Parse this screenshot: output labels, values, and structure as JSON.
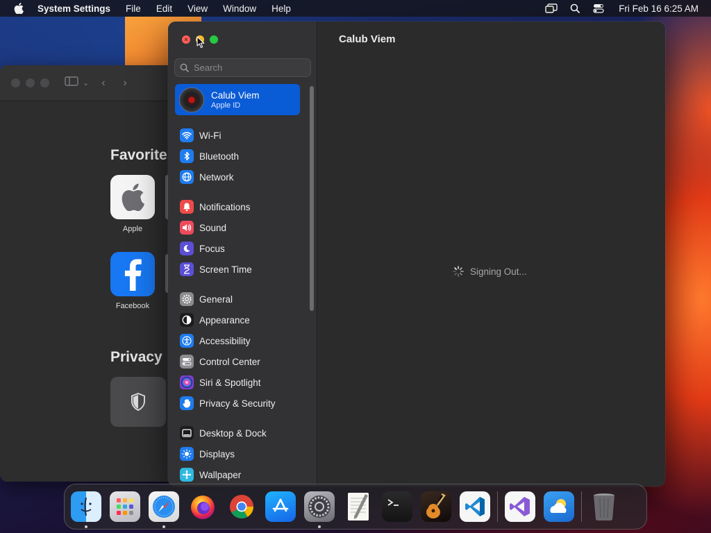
{
  "menubar": {
    "app_name": "System Settings",
    "items": [
      "File",
      "Edit",
      "View",
      "Window",
      "Help"
    ],
    "clock": "Fri Feb 16  6:25 AM"
  },
  "background_window": {
    "favorites_heading": "Favorite",
    "favorites": [
      {
        "label": "Apple",
        "icon": "apple-icon"
      },
      {
        "label": "Facebook",
        "icon": "facebook-icon"
      }
    ],
    "privacy_heading": "Privacy"
  },
  "settings": {
    "search_placeholder": "Search",
    "account": {
      "name": "Calub Viem",
      "subtitle": "Apple ID"
    },
    "nav_groups": [
      [
        {
          "label": "Wi-Fi",
          "icon": "wifi-icon",
          "color": "#1e7cf0"
        },
        {
          "label": "Bluetooth",
          "icon": "bluetooth-icon",
          "color": "#1e7cf0"
        },
        {
          "label": "Network",
          "icon": "globe-icon",
          "color": "#1e7cf0"
        }
      ],
      [
        {
          "label": "Notifications",
          "icon": "bell-icon",
          "color": "#ef4a4a"
        },
        {
          "label": "Sound",
          "icon": "speaker-icon",
          "color": "#ef4a5c"
        },
        {
          "label": "Focus",
          "icon": "moon-icon",
          "color": "#5b4fd6"
        },
        {
          "label": "Screen Time",
          "icon": "hourglass-icon",
          "color": "#5b4fd6"
        }
      ],
      [
        {
          "label": "General",
          "icon": "gear-icon",
          "color": "#8c8c90"
        },
        {
          "label": "Appearance",
          "icon": "appearance-icon",
          "color": "#1c1c1e"
        },
        {
          "label": "Accessibility",
          "icon": "accessibility-icon",
          "color": "#1e7cf0"
        },
        {
          "label": "Control Center",
          "icon": "toggles-icon",
          "color": "#8c8c90"
        },
        {
          "label": "Siri & Spotlight",
          "icon": "siri-icon",
          "color": "#7a3fd0"
        },
        {
          "label": "Privacy & Security",
          "icon": "hand-icon",
          "color": "#1e7cf0"
        }
      ],
      [
        {
          "label": "Desktop & Dock",
          "icon": "dock-icon",
          "color": "#1c1c1e"
        },
        {
          "label": "Displays",
          "icon": "sun-icon",
          "color": "#1e7cf0"
        },
        {
          "label": "Wallpaper",
          "icon": "wallpaper-icon",
          "color": "#2fb8e0"
        }
      ]
    ],
    "content_title": "Calub Viem",
    "status_text": "Signing Out..."
  },
  "dock": {
    "apps": [
      {
        "name": "Finder",
        "icon": "finder-icon",
        "running": true
      },
      {
        "name": "Launchpad",
        "icon": "launchpad-icon",
        "running": false
      },
      {
        "name": "Safari",
        "icon": "safari-icon",
        "running": true
      },
      {
        "name": "Firefox",
        "icon": "firefox-icon",
        "running": false
      },
      {
        "name": "Chrome",
        "icon": "chrome-icon",
        "running": false
      },
      {
        "name": "App Store",
        "icon": "app-store-icon",
        "running": false
      },
      {
        "name": "System Settings",
        "icon": "system-settings-icon",
        "running": true
      },
      {
        "name": "TextEdit",
        "icon": "textedit-icon",
        "running": false
      },
      {
        "name": "Terminal",
        "icon": "terminal-icon",
        "running": false
      },
      {
        "name": "GarageBand",
        "icon": "garageband-icon",
        "running": false
      },
      {
        "name": "Visual Studio Code",
        "icon": "vscode-icon",
        "running": false
      }
    ],
    "recent_apps": [
      {
        "name": "Visual Studio",
        "icon": "visual-studio-icon"
      },
      {
        "name": "Weather",
        "icon": "weather-icon"
      }
    ],
    "trash": {
      "name": "Trash",
      "icon": "trash-icon"
    }
  }
}
